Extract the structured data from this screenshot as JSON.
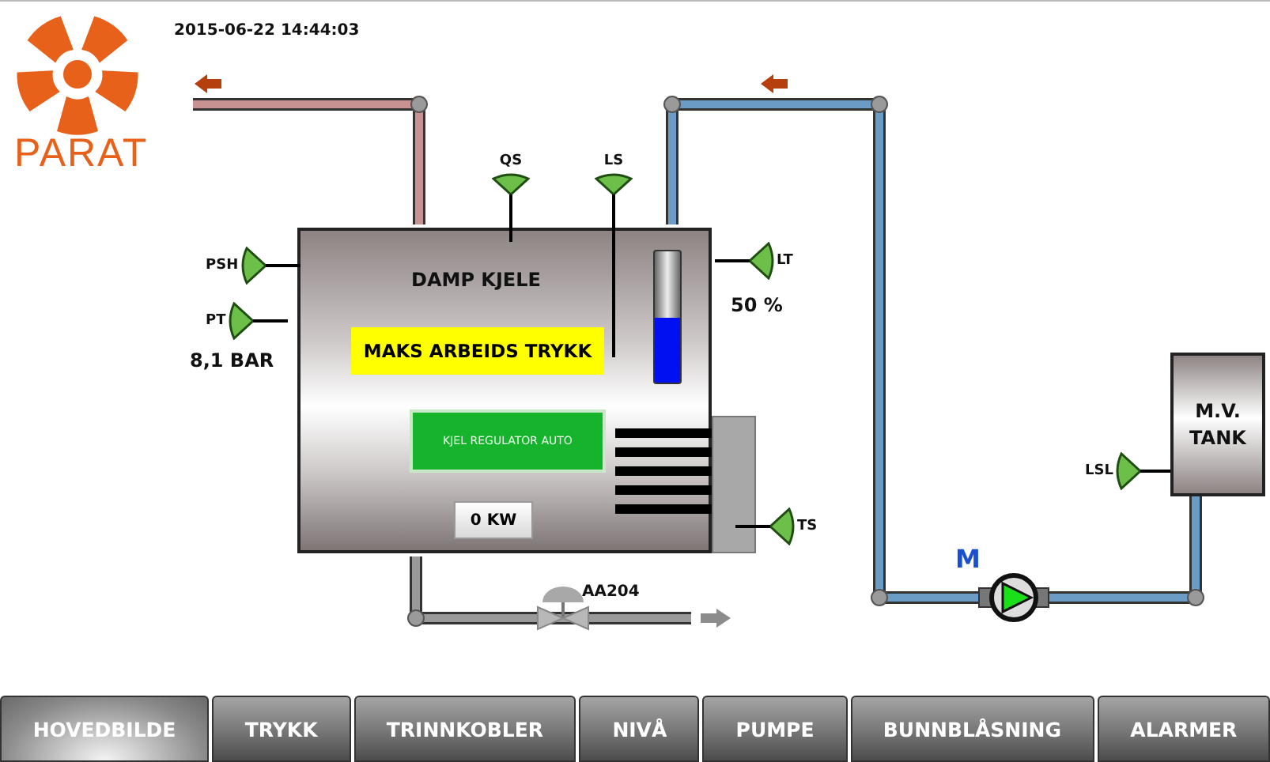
{
  "logo": {
    "text": "PARAT"
  },
  "timestamp": "2015-06-22 14:44:03",
  "boiler": {
    "title": "DAMP KJELE",
    "alarm": "MAKS ARBEIDS TRYKK",
    "regulator": "KJEL REGULATOR AUTO",
    "power": "0 KW",
    "level": 0.5
  },
  "instruments": [
    {
      "tag": "PSH"
    },
    {
      "tag": "PT",
      "reading": "8,1 BAR"
    },
    {
      "tag": "QS"
    },
    {
      "tag": "LS"
    },
    {
      "tag": "LT",
      "reading": "50 %"
    },
    {
      "tag": "TS"
    },
    {
      "tag": "LSL"
    }
  ],
  "valve": {
    "tag": "AA204"
  },
  "pump": {
    "label": "M",
    "running": true
  },
  "tank": {
    "label": "M.V. TANK"
  },
  "tabs": [
    {
      "label": "HOVEDBILDE",
      "selected": true
    },
    {
      "label": "TRYKK",
      "selected": false
    },
    {
      "label": "TRINNKOBLER",
      "selected": false
    },
    {
      "label": "NIVÅ",
      "selected": false
    },
    {
      "label": "PUMPE",
      "selected": false
    },
    {
      "label": "BUNNBLÅSNING",
      "selected": false
    },
    {
      "label": "ALARMER",
      "selected": false
    }
  ]
}
